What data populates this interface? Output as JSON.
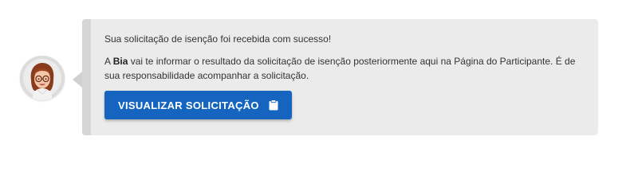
{
  "assistant": {
    "avatar_icon": "assistant-avatar-icon",
    "message_line1": "Sua solicitação de isenção foi recebida com sucesso!",
    "message_line2_prefix": "A ",
    "assistant_name": "Bia",
    "message_line2_suffix": " vai te informar o resultado da solicitação de isenção posteriormente aqui na Página do Participante. É de sua responsabilidade acompanhar a solicitação."
  },
  "action": {
    "button_label": "VISUALIZAR SOLICITAÇÃO",
    "button_icon": "clipboard-icon",
    "button_color": "#1565c0"
  },
  "colors": {
    "card_background": "#ebebeb",
    "card_left_border": "#d6d6d6",
    "text": "#333333"
  }
}
